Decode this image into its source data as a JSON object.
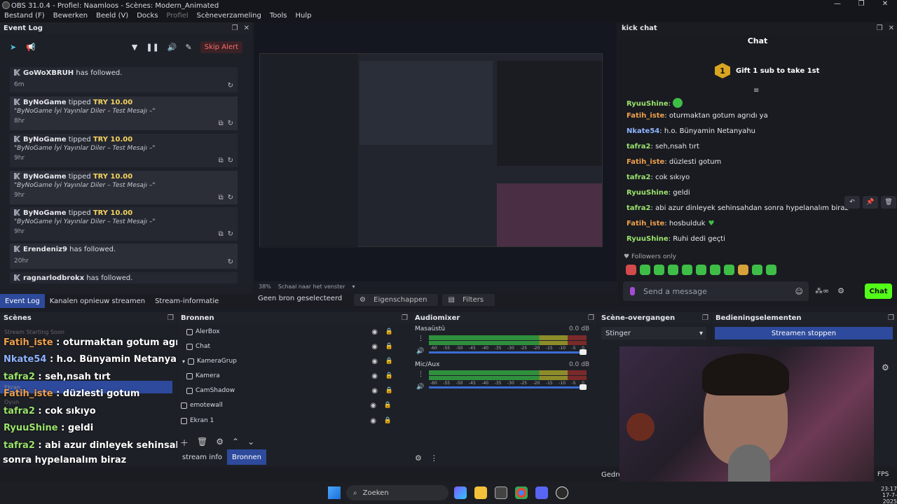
{
  "window": {
    "title": "OBS 31.0.4 - Profiel: Naamloos - Scènes: Modern_Animated"
  },
  "menu": [
    "Bestand (F)",
    "Bewerken",
    "Beeld (V)",
    "Docks",
    "Profiel",
    "Scèneverzameling",
    "Tools",
    "Hulp"
  ],
  "eventlog": {
    "title": "Event Log",
    "skip_label": "Skip Alert",
    "items": [
      {
        "user": "GoWoXBRUH",
        "action": "has followed.",
        "time": "6m"
      },
      {
        "user": "ByNoGame",
        "action": "tipped",
        "amount": "TRY 10.00",
        "message": "\"ByNoGame İyi Yayınlar Diler – Test Mesajı –\"",
        "time": "8hr"
      },
      {
        "user": "ByNoGame",
        "action": "tipped",
        "amount": "TRY 10.00",
        "message": "\"ByNoGame İyi Yayınlar Diler – Test Mesajı –\"",
        "time": "9hr"
      },
      {
        "user": "ByNoGame",
        "action": "tipped",
        "amount": "TRY 10.00",
        "message": "\"ByNoGame İyi Yayınlar Diler – Test Mesajı –\"",
        "time": "9hr"
      },
      {
        "user": "ByNoGame",
        "action": "tipped",
        "amount": "TRY 10.00",
        "message": "\"ByNoGame İyi Yayınlar Diler – Test Mesajı –\"",
        "time": "9hr"
      },
      {
        "user": "Erendeniz9",
        "action": "has followed.",
        "time": "20hr"
      },
      {
        "user": "ragnarlodbrokx",
        "action": "has followed."
      }
    ]
  },
  "dock_tabs": [
    "Event Log",
    "Kanalen opnieuw streamen",
    "Stream-informatie"
  ],
  "preview": {
    "zoom": "38%",
    "zoom_mode": "Schaal naar het venster",
    "no_source": "Geen bron geselecteerd",
    "properties": "Eigenschappen",
    "filters": "Filters"
  },
  "kickchat": {
    "dock_title": "kick chat",
    "title": "Chat",
    "gift_count": "1",
    "gift_text": "Gift 1 sub to take 1st",
    "messages": [
      {
        "user": "RyuuShine",
        "text": "",
        "color": "#9be36b"
      },
      {
        "user": "Fatih_iste",
        "text": "oturmaktan gotum agrıdı ya",
        "color": "#f0a04b"
      },
      {
        "user": "Nkate54",
        "text": "h.o. Bünyamin Netanyahu",
        "color": "#8fb4ff"
      },
      {
        "user": "tafra2",
        "text": "seh,nsah tırt",
        "color": "#9be36b"
      },
      {
        "user": "Fatih_iste",
        "text": "düzlesti gotum",
        "color": "#f0a04b"
      },
      {
        "user": "tafra2",
        "text": "cok sıkıyo",
        "color": "#9be36b"
      },
      {
        "user": "RyuuShine",
        "text": "geldi",
        "color": "#9be36b"
      },
      {
        "user": "tafra2",
        "text": "abi azur dinleyek sehinsahdan sonra hypelanalım biraz",
        "color": "#9be36b"
      },
      {
        "user": "Fatih_iste",
        "text": "hosbulduk",
        "color": "#f0a04b"
      },
      {
        "user": "RyuuShine",
        "text": "Ruhi dedi geçti",
        "color": "#9be36b"
      }
    ],
    "followers_only": "Followers only",
    "placeholder": "Send a message",
    "send_label": "Chat"
  },
  "scenes": {
    "title": "Scènes",
    "overlay_lines": [
      {
        "user": "Fatih_iste",
        "text": " : oturmaktan gotum agrıdı ya",
        "color": "#f0a04b"
      },
      {
        "user": "Nkate54",
        "text": " : h.o. Bünyamin Netanyahu",
        "color": "#8fb4ff"
      },
      {
        "user": "tafra2",
        "text": " : seh,nsah tırt",
        "color": "#9be36b"
      },
      {
        "user": "Fatih_iste",
        "text": " : düzlesti gotum",
        "color": "#f0a04b"
      },
      {
        "user": "tafra2",
        "text": " : cok sıkıyo",
        "color": "#9be36b"
      },
      {
        "user": "RyuuShine",
        "text": " : geldi",
        "color": "#9be36b"
      },
      {
        "user": "tafra2",
        "text": " : abi azur dinleyek sehinsahdan",
        "color": "#9be36b"
      },
      {
        "user": "",
        "text": "sonra hypelanalım biraz",
        "color": "#ffffff"
      },
      {
        "user": "Fatih_iste",
        "text": " : hosbulduk",
        "color": "#f0a04b"
      },
      {
        "user": "RyuuShine",
        "text": " : Ruhi dedi geçti",
        "color": "#9be36b"
      }
    ],
    "hidden_items": [
      "Stream Starting Soon",
      "Ekran",
      "Oyun"
    ]
  },
  "sources": {
    "title": "Bronnen",
    "items": [
      "AlerBox",
      "Chat",
      "KameraGrup",
      "Kamera",
      "CamShadow",
      "emotewall",
      "Ekran 1"
    ],
    "tabs": [
      "stream info",
      "Bronnen"
    ]
  },
  "mixer": {
    "title": "Audiomixer",
    "channels": [
      {
        "name": "Masaüstü",
        "db": "0.0 dB"
      },
      {
        "name": "Mic/Aux",
        "db": "0.0 dB"
      }
    ],
    "scale": [
      "-60",
      "-55",
      "-50",
      "-45",
      "-40",
      "-35",
      "-30",
      "-25",
      "-20",
      "-15",
      "-10",
      "-5",
      "0"
    ]
  },
  "transitions": {
    "title": "Scène-overgangen",
    "selected": "Stinger"
  },
  "controls": {
    "title": "Bedieningselementen",
    "stop_label": "Streamen stoppen"
  },
  "statusbar": {
    "left": "Gedro",
    "fps": "FPS"
  },
  "taskbar": {
    "search_placeholder": "Zoeken",
    "time": "23:17",
    "date": "17-7-2025"
  }
}
